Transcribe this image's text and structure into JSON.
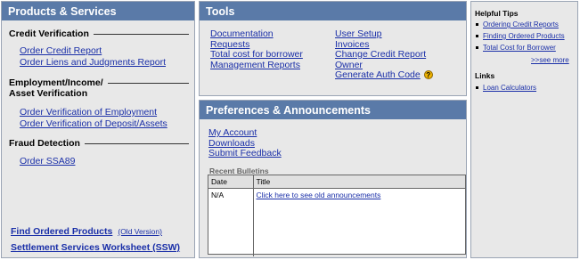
{
  "products": {
    "header": "Products & Services",
    "credit_verification": {
      "title": "Credit Verification",
      "links": [
        "Order Credit Report",
        "Order Liens and Judgments Report"
      ]
    },
    "employment": {
      "title_line1": "Employment/Income/",
      "title_line2": "Asset Verification",
      "links": [
        "Order Verification of Employment",
        "Order Verification of Deposit/Assets"
      ]
    },
    "fraud": {
      "title": "Fraud Detection",
      "links": [
        "Order SSA89"
      ]
    },
    "find_ordered": "Find Ordered Products",
    "old_version": "(Old Version)",
    "settlement": "Settlement Services Worksheet (SSW)"
  },
  "tools": {
    "header": "Tools",
    "col1": [
      "Documentation",
      "Requests",
      "Total cost for borrower",
      "Management Reports"
    ],
    "col2": [
      "User Setup",
      "Invoices",
      "Change Credit Report",
      "Owner",
      "Generate Auth Code"
    ],
    "help_badge": "?"
  },
  "prefs": {
    "header": "Preferences & Announcements",
    "links": [
      "My Account",
      "Downloads",
      "Submit Feedback"
    ],
    "bulletins_title": "Recent Bulletins",
    "table": {
      "headers": [
        "Date",
        "Title"
      ],
      "rows": [
        [
          "N/A",
          "Click here to see old announcements"
        ]
      ]
    }
  },
  "tips": {
    "helpful_title": "Helpful Tips",
    "items": [
      "Ordering Credit Reports",
      "Finding Ordered Products",
      "Total Cost for Borrower"
    ],
    "see_more": ">>see more",
    "links_title": "Links",
    "links": [
      "Loan Calculators"
    ]
  }
}
